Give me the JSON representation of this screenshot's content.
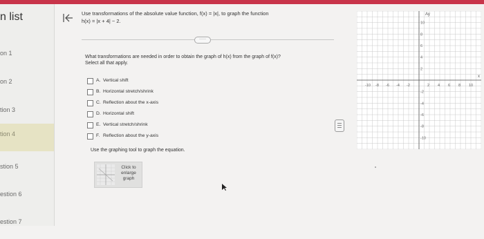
{
  "sidebar": {
    "title": "n list",
    "items": [
      {
        "label": "on 1"
      },
      {
        "label": "on 2"
      },
      {
        "label": "tion 3"
      },
      {
        "label": "tion 4"
      },
      {
        "label": "stion 5"
      },
      {
        "label": "estion 6"
      },
      {
        "label": "estion 7"
      }
    ]
  },
  "question": {
    "line1": "Use transformations of the absolute value function, f(x) = |x|, to graph the function",
    "line2": "h(x) = |x + 4| − 2.",
    "more_label": "·····",
    "prompt_line1": "What transformations are needed in order to obtain the graph of h(x) from the graph of f(x)?",
    "prompt_line2": "Select all that apply.",
    "options": [
      {
        "letter": "A.",
        "text": "Vertical shift"
      },
      {
        "letter": "B.",
        "text": "Horizontal stretch/shrink"
      },
      {
        "letter": "C.",
        "text": "Reflection about the x-axis"
      },
      {
        "letter": "D.",
        "text": "Horizontal shift"
      },
      {
        "letter": "E.",
        "text": "Vertical stretch/shrink"
      },
      {
        "letter": "F.",
        "text": "Reflection about the y-axis"
      }
    ],
    "graph_instruction": "Use the graphing tool to graph the equation.",
    "enlarge_line1": "Click to",
    "enlarge_line2": "enlarge",
    "enlarge_line3": "graph"
  },
  "graph": {
    "y_axis_label": "Ay",
    "x_axis_label": "x",
    "x_tick_labels": [
      "-10",
      "-8",
      "-6",
      "-4",
      "-2",
      "2",
      "4",
      "6",
      "8",
      "10"
    ],
    "y_tick_labels": [
      "10",
      "8",
      "6",
      "4",
      "2",
      "-2",
      "-4",
      "-6",
      "-8",
      "-10"
    ]
  },
  "colors": {
    "accent_bar": "#c8344a",
    "grid_line": "#c9c9c9",
    "axis": "#555555"
  }
}
